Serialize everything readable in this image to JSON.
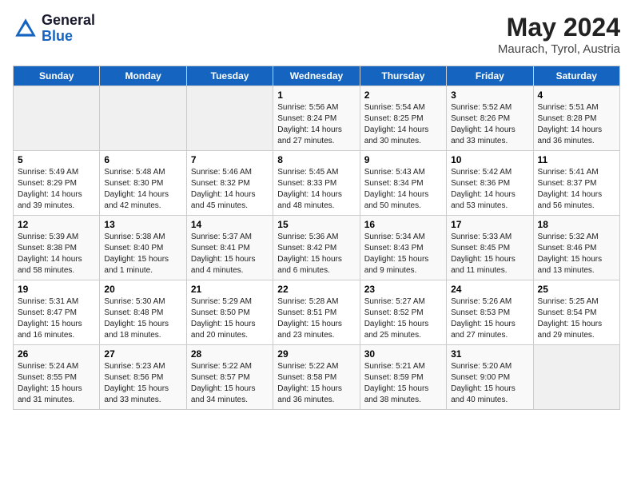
{
  "header": {
    "logo_general": "General",
    "logo_blue": "Blue",
    "title": "May 2024",
    "subtitle": "Maurach, Tyrol, Austria"
  },
  "weekdays": [
    "Sunday",
    "Monday",
    "Tuesday",
    "Wednesday",
    "Thursday",
    "Friday",
    "Saturday"
  ],
  "weeks": [
    [
      {
        "day": "",
        "info": ""
      },
      {
        "day": "",
        "info": ""
      },
      {
        "day": "",
        "info": ""
      },
      {
        "day": "1",
        "info": "Sunrise: 5:56 AM\nSunset: 8:24 PM\nDaylight: 14 hours\nand 27 minutes."
      },
      {
        "day": "2",
        "info": "Sunrise: 5:54 AM\nSunset: 8:25 PM\nDaylight: 14 hours\nand 30 minutes."
      },
      {
        "day": "3",
        "info": "Sunrise: 5:52 AM\nSunset: 8:26 PM\nDaylight: 14 hours\nand 33 minutes."
      },
      {
        "day": "4",
        "info": "Sunrise: 5:51 AM\nSunset: 8:28 PM\nDaylight: 14 hours\nand 36 minutes."
      }
    ],
    [
      {
        "day": "5",
        "info": "Sunrise: 5:49 AM\nSunset: 8:29 PM\nDaylight: 14 hours\nand 39 minutes."
      },
      {
        "day": "6",
        "info": "Sunrise: 5:48 AM\nSunset: 8:30 PM\nDaylight: 14 hours\nand 42 minutes."
      },
      {
        "day": "7",
        "info": "Sunrise: 5:46 AM\nSunset: 8:32 PM\nDaylight: 14 hours\nand 45 minutes."
      },
      {
        "day": "8",
        "info": "Sunrise: 5:45 AM\nSunset: 8:33 PM\nDaylight: 14 hours\nand 48 minutes."
      },
      {
        "day": "9",
        "info": "Sunrise: 5:43 AM\nSunset: 8:34 PM\nDaylight: 14 hours\nand 50 minutes."
      },
      {
        "day": "10",
        "info": "Sunrise: 5:42 AM\nSunset: 8:36 PM\nDaylight: 14 hours\nand 53 minutes."
      },
      {
        "day": "11",
        "info": "Sunrise: 5:41 AM\nSunset: 8:37 PM\nDaylight: 14 hours\nand 56 minutes."
      }
    ],
    [
      {
        "day": "12",
        "info": "Sunrise: 5:39 AM\nSunset: 8:38 PM\nDaylight: 14 hours\nand 58 minutes."
      },
      {
        "day": "13",
        "info": "Sunrise: 5:38 AM\nSunset: 8:40 PM\nDaylight: 15 hours\nand 1 minute."
      },
      {
        "day": "14",
        "info": "Sunrise: 5:37 AM\nSunset: 8:41 PM\nDaylight: 15 hours\nand 4 minutes."
      },
      {
        "day": "15",
        "info": "Sunrise: 5:36 AM\nSunset: 8:42 PM\nDaylight: 15 hours\nand 6 minutes."
      },
      {
        "day": "16",
        "info": "Sunrise: 5:34 AM\nSunset: 8:43 PM\nDaylight: 15 hours\nand 9 minutes."
      },
      {
        "day": "17",
        "info": "Sunrise: 5:33 AM\nSunset: 8:45 PM\nDaylight: 15 hours\nand 11 minutes."
      },
      {
        "day": "18",
        "info": "Sunrise: 5:32 AM\nSunset: 8:46 PM\nDaylight: 15 hours\nand 13 minutes."
      }
    ],
    [
      {
        "day": "19",
        "info": "Sunrise: 5:31 AM\nSunset: 8:47 PM\nDaylight: 15 hours\nand 16 minutes."
      },
      {
        "day": "20",
        "info": "Sunrise: 5:30 AM\nSunset: 8:48 PM\nDaylight: 15 hours\nand 18 minutes."
      },
      {
        "day": "21",
        "info": "Sunrise: 5:29 AM\nSunset: 8:50 PM\nDaylight: 15 hours\nand 20 minutes."
      },
      {
        "day": "22",
        "info": "Sunrise: 5:28 AM\nSunset: 8:51 PM\nDaylight: 15 hours\nand 23 minutes."
      },
      {
        "day": "23",
        "info": "Sunrise: 5:27 AM\nSunset: 8:52 PM\nDaylight: 15 hours\nand 25 minutes."
      },
      {
        "day": "24",
        "info": "Sunrise: 5:26 AM\nSunset: 8:53 PM\nDaylight: 15 hours\nand 27 minutes."
      },
      {
        "day": "25",
        "info": "Sunrise: 5:25 AM\nSunset: 8:54 PM\nDaylight: 15 hours\nand 29 minutes."
      }
    ],
    [
      {
        "day": "26",
        "info": "Sunrise: 5:24 AM\nSunset: 8:55 PM\nDaylight: 15 hours\nand 31 minutes."
      },
      {
        "day": "27",
        "info": "Sunrise: 5:23 AM\nSunset: 8:56 PM\nDaylight: 15 hours\nand 33 minutes."
      },
      {
        "day": "28",
        "info": "Sunrise: 5:22 AM\nSunset: 8:57 PM\nDaylight: 15 hours\nand 34 minutes."
      },
      {
        "day": "29",
        "info": "Sunrise: 5:22 AM\nSunset: 8:58 PM\nDaylight: 15 hours\nand 36 minutes."
      },
      {
        "day": "30",
        "info": "Sunrise: 5:21 AM\nSunset: 8:59 PM\nDaylight: 15 hours\nand 38 minutes."
      },
      {
        "day": "31",
        "info": "Sunrise: 5:20 AM\nSunset: 9:00 PM\nDaylight: 15 hours\nand 40 minutes."
      },
      {
        "day": "",
        "info": ""
      }
    ]
  ]
}
